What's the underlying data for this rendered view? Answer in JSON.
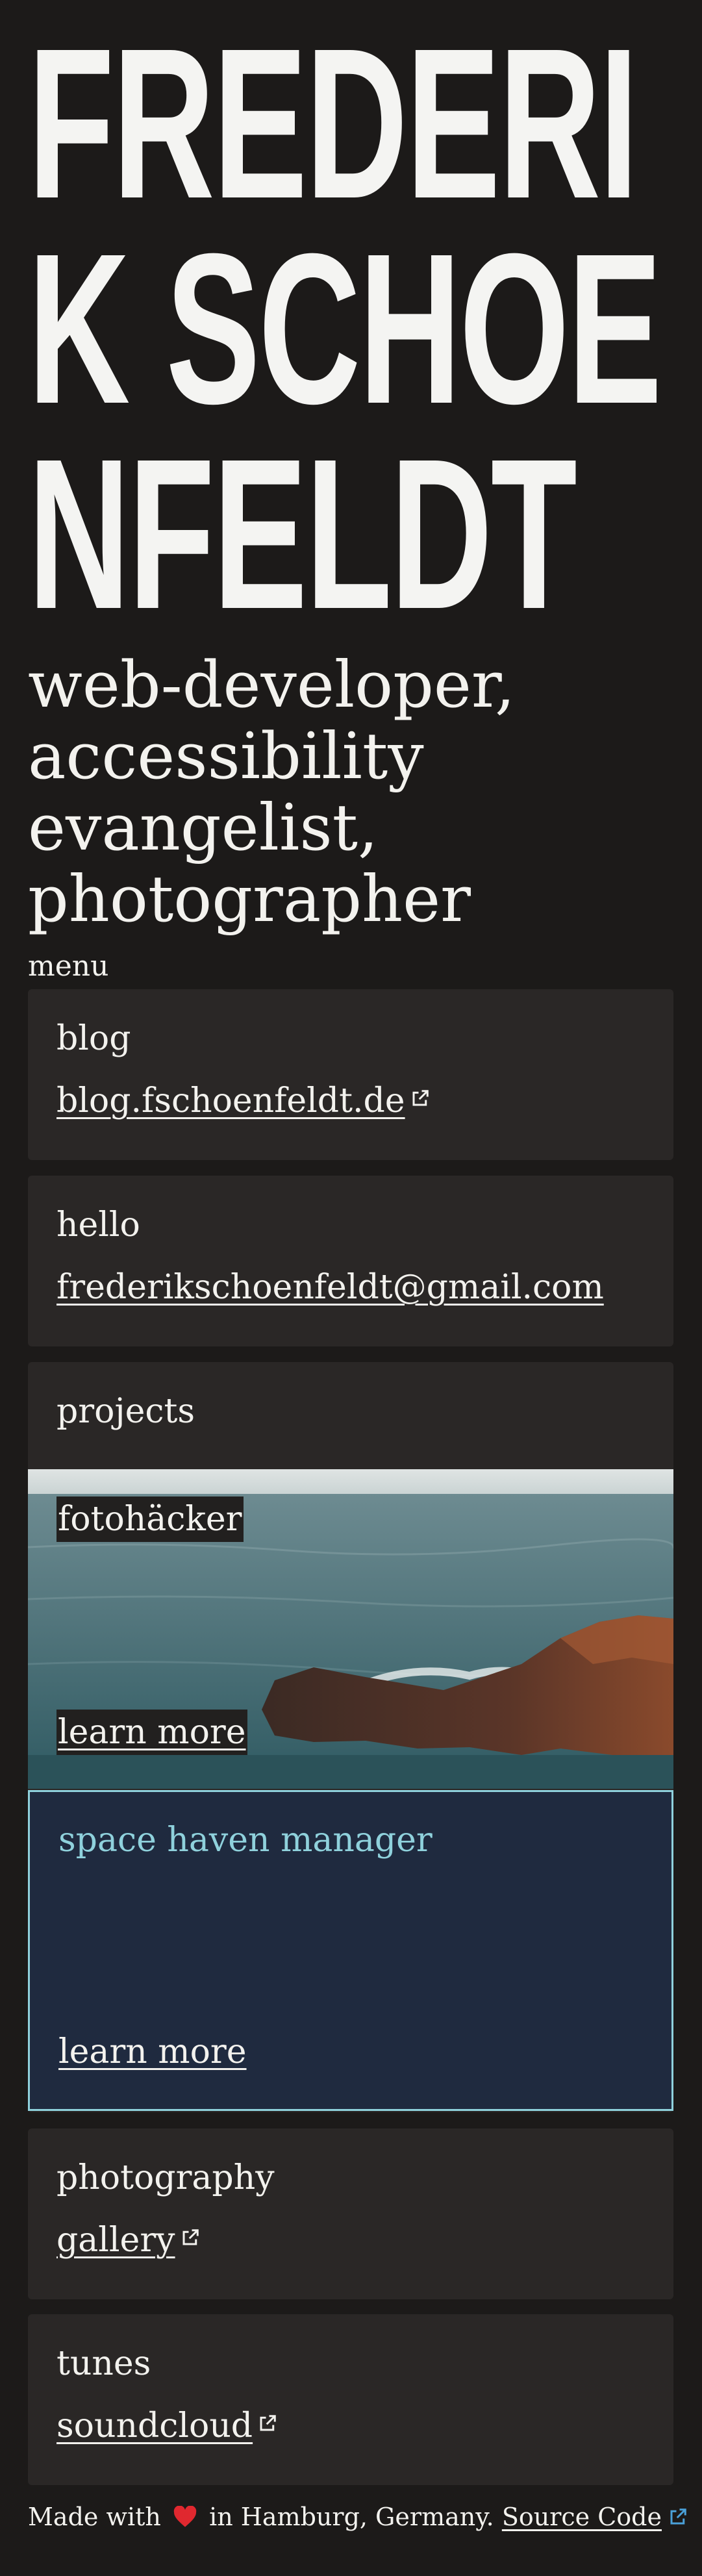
{
  "hero": {
    "name": "FREDERIK SCHOENFELDT"
  },
  "subtitle": "web-developer, accessibility evangelist, photographer",
  "menu_label": "menu",
  "cards": {
    "blog": {
      "title": "blog",
      "link": "blog.fschoenfeldt.de"
    },
    "hello": {
      "title": "hello",
      "link": "frederikschoenfeldt@gmail.com"
    },
    "projects": {
      "title": "projects"
    },
    "photography": {
      "title": "photography",
      "link": "gallery"
    },
    "tunes": {
      "title": "tunes",
      "link": "soundcloud"
    }
  },
  "projects": {
    "fotohacker": {
      "title": "fotohäcker",
      "cta": "learn more"
    },
    "space_haven": {
      "title": "space haven manager",
      "cta": "learn more"
    }
  },
  "footer": {
    "made_with": "Made with",
    "location": "in Hamburg, Germany.",
    "source": "Source Code"
  },
  "colors": {
    "background": "#1c1a19",
    "card": "#2a2726",
    "space_bg": "#1f2a3f",
    "space_accent": "#8fd1dc",
    "heart": "#e0282f"
  },
  "icons": {
    "external_link": "external-link-icon",
    "heart": "heart-icon"
  }
}
